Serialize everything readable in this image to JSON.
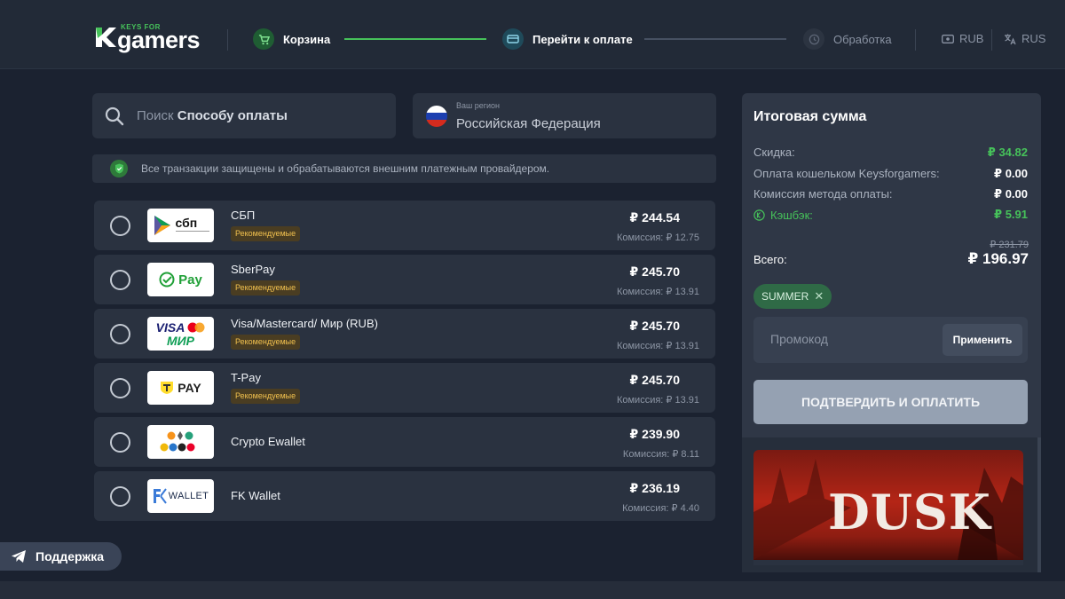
{
  "header": {
    "logo_small": "KEYS FOR",
    "logo_big": "gamers",
    "steps": [
      {
        "label": "Корзина",
        "state": "done"
      },
      {
        "label": "Перейти к оплате",
        "state": "active"
      },
      {
        "label": "Обработка",
        "state": "pending"
      }
    ],
    "currency": "RUB",
    "language": "RUS"
  },
  "search": {
    "prefix": "Поиск",
    "bold": "Способу оплаты"
  },
  "region": {
    "label": "Ваш регион",
    "value": "Российская Федерация"
  },
  "secure_note": "Все транзакции защищены и обрабатываются внешним платежным провайдером.",
  "payment_methods": [
    {
      "name": "СБП",
      "badge": "Рекомендуемые",
      "price": "₽ 244.54",
      "commission": "Комиссия: ₽ 12.75",
      "logo": "sbp"
    },
    {
      "name": "SberPay",
      "badge": "Рекомендуемые",
      "price": "₽ 245.70",
      "commission": "Комиссия: ₽ 13.91",
      "logo": "sberpay"
    },
    {
      "name": "Visa/Mastercard/ Мир (RUB)",
      "badge": "Рекомендуемые",
      "price": "₽ 245.70",
      "commission": "Комиссия: ₽ 13.91",
      "logo": "visa-mir"
    },
    {
      "name": "T-Pay",
      "badge": "Рекомендуемые",
      "price": "₽ 245.70",
      "commission": "Комиссия: ₽ 13.91",
      "logo": "tpay"
    },
    {
      "name": "Crypto Ewallet",
      "badge": "",
      "price": "₽ 239.90",
      "commission": "Комиссия: ₽ 8.11",
      "logo": "crypto"
    },
    {
      "name": "FK Wallet",
      "badge": "",
      "price": "₽ 236.19",
      "commission": "Комиссия: ₽ 4.40",
      "logo": "fkwallet"
    }
  ],
  "logos": {
    "sbp": "сбп",
    "sberpay": "Pay",
    "visa": "VISA",
    "mir": "МИР",
    "tpay": "PAY",
    "fk": "WALLET"
  },
  "support_label": "Поддержка",
  "summary": {
    "title": "Итоговая сумма",
    "rows": [
      {
        "label": "Скидка:",
        "value": "₽ 34.82"
      },
      {
        "label": "Оплата кошельком Keysforgamers:",
        "value": "₽ 0.00"
      },
      {
        "label": "Комиссия метода оплаты:",
        "value": "₽ 0.00"
      },
      {
        "label": "Кэшбэк:",
        "value": "₽ 5.91"
      }
    ],
    "old_total": "₽ 231.79",
    "total_label": "Всего:",
    "total": "₽ 196.97",
    "coupon": "SUMMER",
    "promo_placeholder": "Промокод",
    "apply_label": "Применить",
    "confirm_label": "ПОДТВЕРДИТЬ И ОПЛАТИТЬ"
  },
  "promo_game": {
    "title": "DUSK"
  },
  "colors": {
    "accent_green": "#46c25a",
    "badge_yellow": "#f2c14e",
    "background": "#1b2230"
  }
}
